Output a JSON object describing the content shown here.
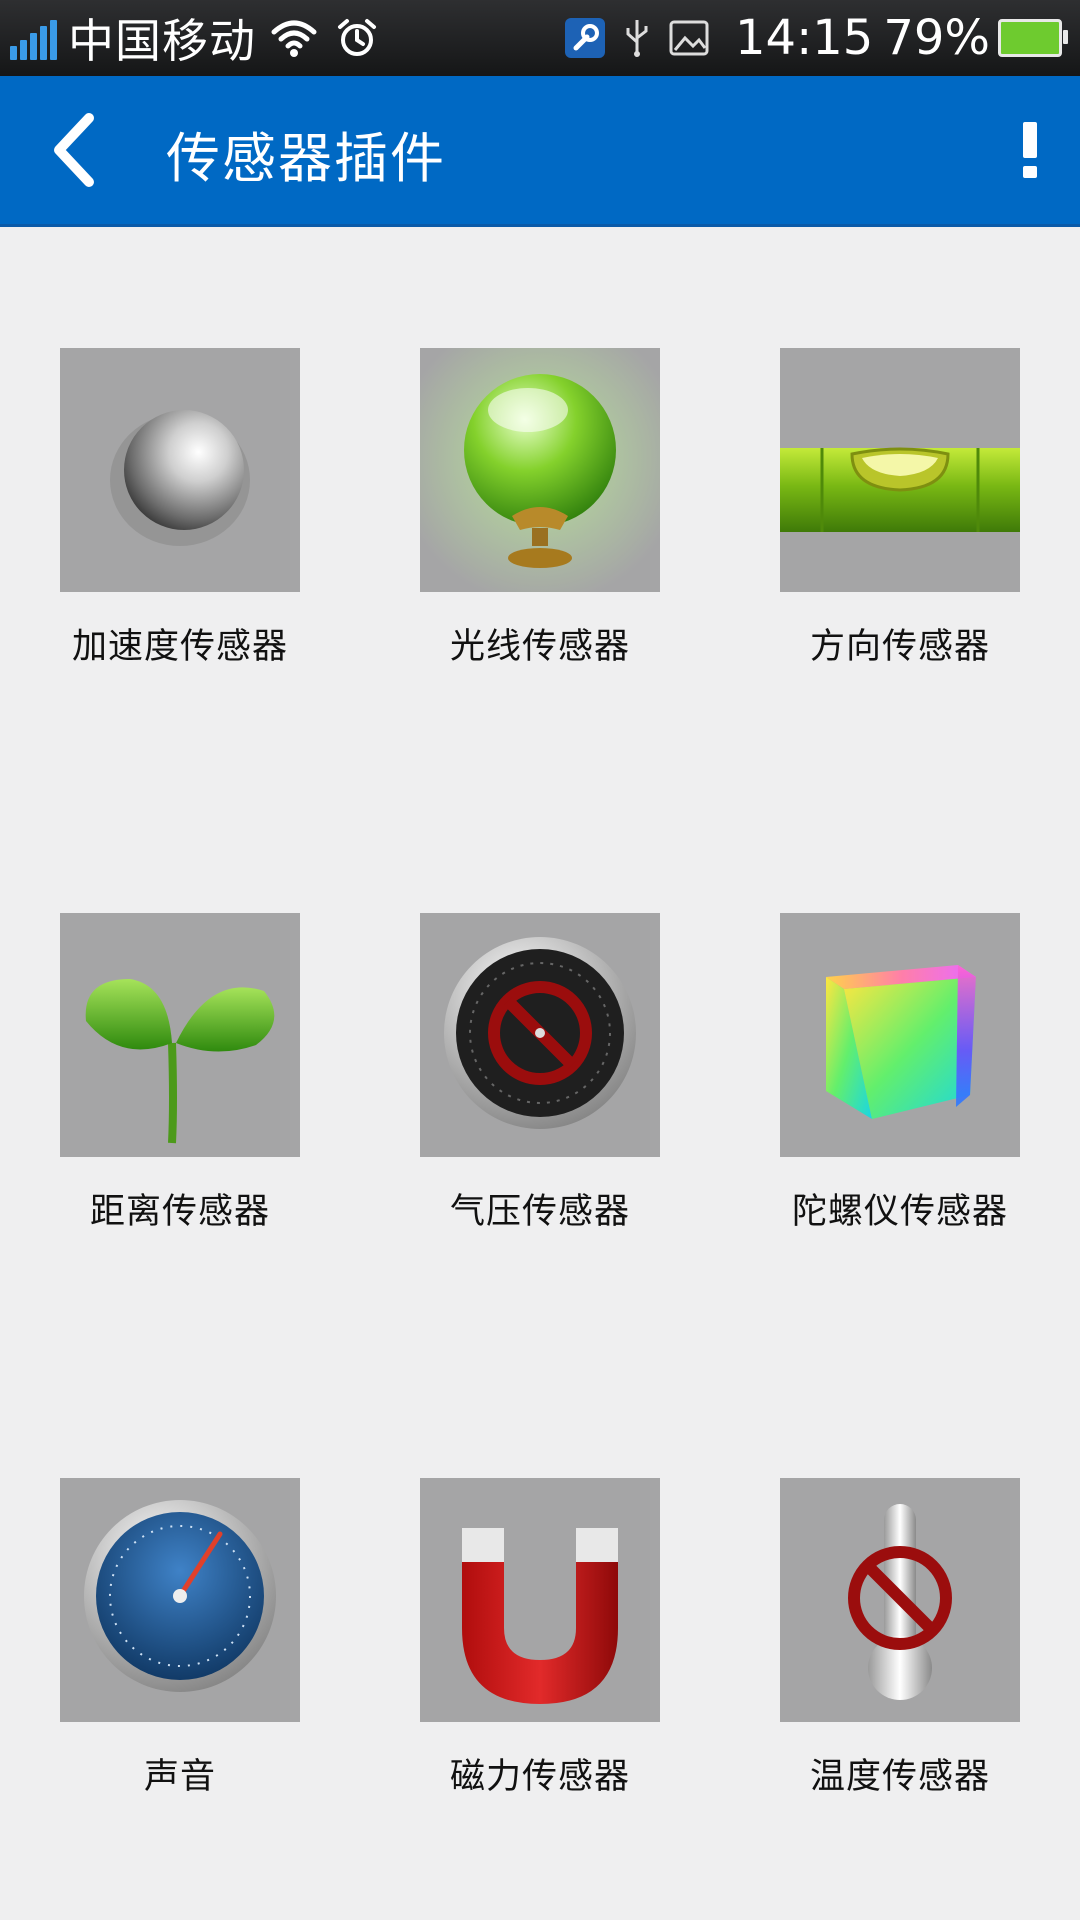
{
  "status_bar": {
    "carrier": "中国移动",
    "time": "14:15",
    "battery": "79%",
    "icons": [
      "signal-icon",
      "wifi-icon",
      "alarm-icon",
      "wrench-icon",
      "usb-icon",
      "image-icon",
      "battery-icon"
    ]
  },
  "app_bar": {
    "title": "传感器插件",
    "back_icon": "back-icon",
    "info_icon": "info-icon"
  },
  "sensors": [
    {
      "label": "加速度传感器",
      "icon": "metal-ball-icon"
    },
    {
      "label": "光线传感器",
      "icon": "crystal-ball-icon"
    },
    {
      "label": "方向传感器",
      "icon": "spirit-level-icon"
    },
    {
      "label": "距离传感器",
      "icon": "sprout-icon"
    },
    {
      "label": "气压传感器",
      "icon": "barometer-disabled-icon"
    },
    {
      "label": "陀螺仪传感器",
      "icon": "color-cube-icon"
    },
    {
      "label": "声音",
      "icon": "speedometer-icon"
    },
    {
      "label": "磁力传感器",
      "icon": "magnet-icon"
    },
    {
      "label": "温度传感器",
      "icon": "thermometer-disabled-icon"
    }
  ],
  "colors": {
    "app_bar": "#0069c4",
    "background": "#efeff0",
    "tile": "#a5a5a6"
  }
}
